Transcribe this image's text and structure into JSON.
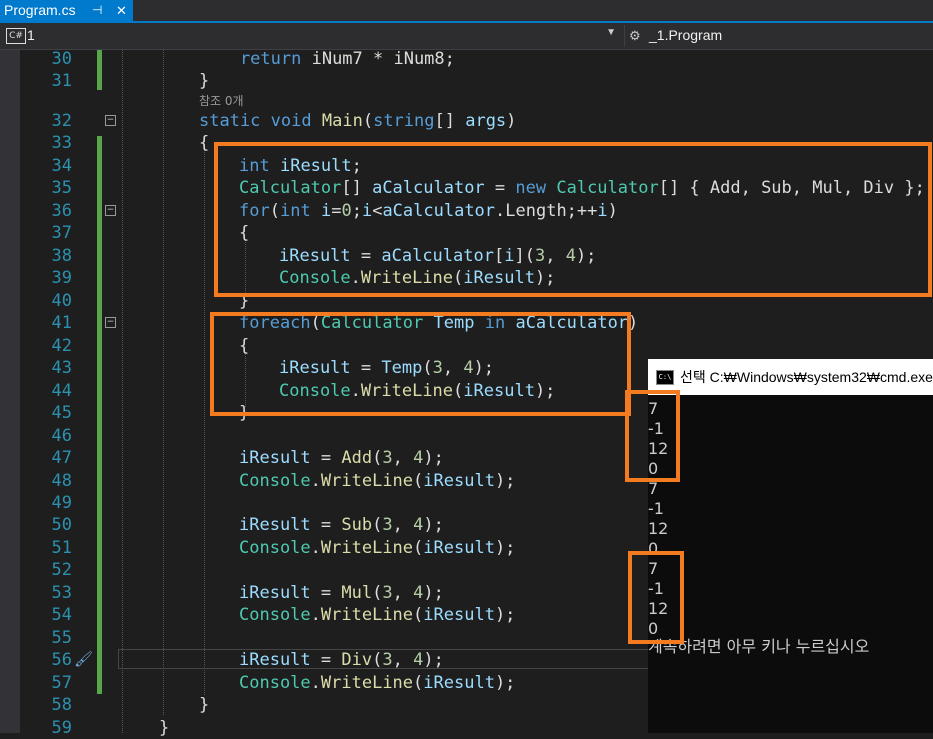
{
  "tab": {
    "name": "Program.cs",
    "pin": "⊣",
    "close": "✕"
  },
  "nav": {
    "project_icon": "C#",
    "project": "1",
    "member_icon": "class-icon",
    "member": "_1.Program"
  },
  "reference_text": "참조 0개",
  "lines": [
    {
      "n": "30",
      "code": "            return iNum7 * iNum8;"
    },
    {
      "n": "31",
      "code": "        }"
    },
    {
      "n": "32",
      "code": "        static void Main(string[] args)"
    },
    {
      "n": "33",
      "code": "        {"
    },
    {
      "n": "34",
      "code": "            int iResult;"
    },
    {
      "n": "35",
      "code": "            Calculator[] aCalculator = new Calculator[] { Add, Sub, Mul, Div };"
    },
    {
      "n": "36",
      "code": "            for(int i=0;i<aCalculator.Length;++i)"
    },
    {
      "n": "37",
      "code": "            {"
    },
    {
      "n": "38",
      "code": "                iResult = aCalculator[i](3, 4);"
    },
    {
      "n": "39",
      "code": "                Console.WriteLine(iResult);"
    },
    {
      "n": "40",
      "code": "            }"
    },
    {
      "n": "41",
      "code": "            foreach(Calculator Temp in aCalculator)"
    },
    {
      "n": "42",
      "code": "            {"
    },
    {
      "n": "43",
      "code": "                iResult = Temp(3, 4);"
    },
    {
      "n": "44",
      "code": "                Console.WriteLine(iResult);"
    },
    {
      "n": "45",
      "code": "            }"
    },
    {
      "n": "46",
      "code": ""
    },
    {
      "n": "47",
      "code": "            iResult = Add(3, 4);"
    },
    {
      "n": "48",
      "code": "            Console.WriteLine(iResult);"
    },
    {
      "n": "49",
      "code": ""
    },
    {
      "n": "50",
      "code": "            iResult = Sub(3, 4);"
    },
    {
      "n": "51",
      "code": "            Console.WriteLine(iResult);"
    },
    {
      "n": "52",
      "code": ""
    },
    {
      "n": "53",
      "code": "            iResult = Mul(3, 4);"
    },
    {
      "n": "54",
      "code": "            Console.WriteLine(iResult);"
    },
    {
      "n": "55",
      "code": ""
    },
    {
      "n": "56",
      "code": "            iResult = Div(3, 4);"
    },
    {
      "n": "57",
      "code": "            Console.WriteLine(iResult);"
    },
    {
      "n": "58",
      "code": "        }"
    },
    {
      "n": "59",
      "code": "    }"
    }
  ],
  "console": {
    "icon": "C:\\",
    "title": "선택 C:₩Windows₩system32₩cmd.exe",
    "output": [
      "7",
      "-1",
      "12",
      "0",
      "7",
      "-1",
      "12",
      "0",
      "7",
      "-1",
      "12",
      "0",
      "계속하려면 아무 키나 누르십시오"
    ]
  },
  "colors": {
    "accent": "#007acc",
    "highlight_box": "#f47b20",
    "keyword": "#569cd6",
    "type": "#4ec9b0",
    "method": "#dcdcaa",
    "number": "#b5cea8",
    "line_number": "#2b91af"
  }
}
